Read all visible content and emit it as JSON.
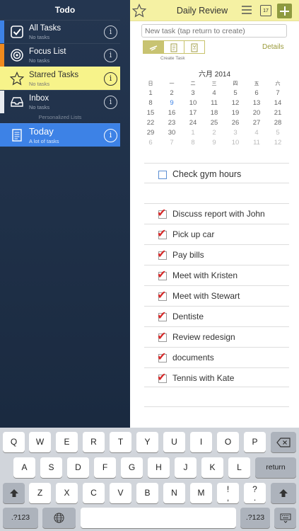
{
  "sidebar": {
    "title": "Todo",
    "items": [
      {
        "label": "All Tasks",
        "sub": "No tasks"
      },
      {
        "label": "Focus List",
        "sub": "No tasks"
      },
      {
        "label": "Starred Tasks",
        "sub": "No tasks"
      },
      {
        "label": "Inbox",
        "sub": "No tasks"
      },
      {
        "label": "Today",
        "sub": "A lot of tasks"
      }
    ],
    "personalized_label": "Personalized Lists",
    "info_glyph": "i",
    "colors": {
      "all_tasks": "#3d82e6",
      "focus": "#f08a1e",
      "starred": "#f7f38a",
      "today": "#3d82e6"
    }
  },
  "header": {
    "title": "Daily Review",
    "calendar_day": "17"
  },
  "new_task": {
    "placeholder": "New task (tap return to create)"
  },
  "create_label": "Create Task",
  "details_label": "Details",
  "calendar": {
    "title": "六月  2014",
    "weekdays": [
      "日",
      "一",
      "二",
      "三",
      "四",
      "五",
      "六"
    ],
    "weeks": [
      [
        "1",
        "2",
        "3",
        "4",
        "5",
        "6",
        "7"
      ],
      [
        "8",
        "9",
        "10",
        "11",
        "12",
        "13",
        "14"
      ],
      [
        "15",
        "16",
        "17",
        "18",
        "19",
        "20",
        "21"
      ],
      [
        "22",
        "23",
        "24",
        "25",
        "26",
        "27",
        "28"
      ],
      [
        "29",
        "30",
        "1",
        "2",
        "3",
        "4",
        "5"
      ],
      [
        "6",
        "7",
        "8",
        "9",
        "10",
        "11",
        "12"
      ]
    ],
    "today": "9"
  },
  "tasks": {
    "unchecked": "Check gym hours",
    "checked": [
      "Discuss report with John",
      "Pick up car",
      "Pay bills",
      "Meet with Kristen",
      "Meet with  Stewart",
      "Dentiste",
      "Review redesign",
      "documents",
      "Tennis with Kate"
    ],
    "check_glyph": "✔"
  },
  "keyboard": {
    "row1": [
      "Q",
      "W",
      "E",
      "R",
      "T",
      "Y",
      "U",
      "I",
      "O",
      "P"
    ],
    "row2": [
      "A",
      "S",
      "D",
      "F",
      "G",
      "H",
      "J",
      "K",
      "L"
    ],
    "row3": [
      "Z",
      "X",
      "C",
      "V",
      "B",
      "N",
      "M",
      "!\n,",
      "?\n."
    ],
    "return": "return",
    "num": ".?123",
    "backspace_icon": "backspace-icon",
    "shift_icon": "shift-icon",
    "globe_icon": "globe-icon",
    "hide_icon": "keyboard-hide-icon"
  }
}
